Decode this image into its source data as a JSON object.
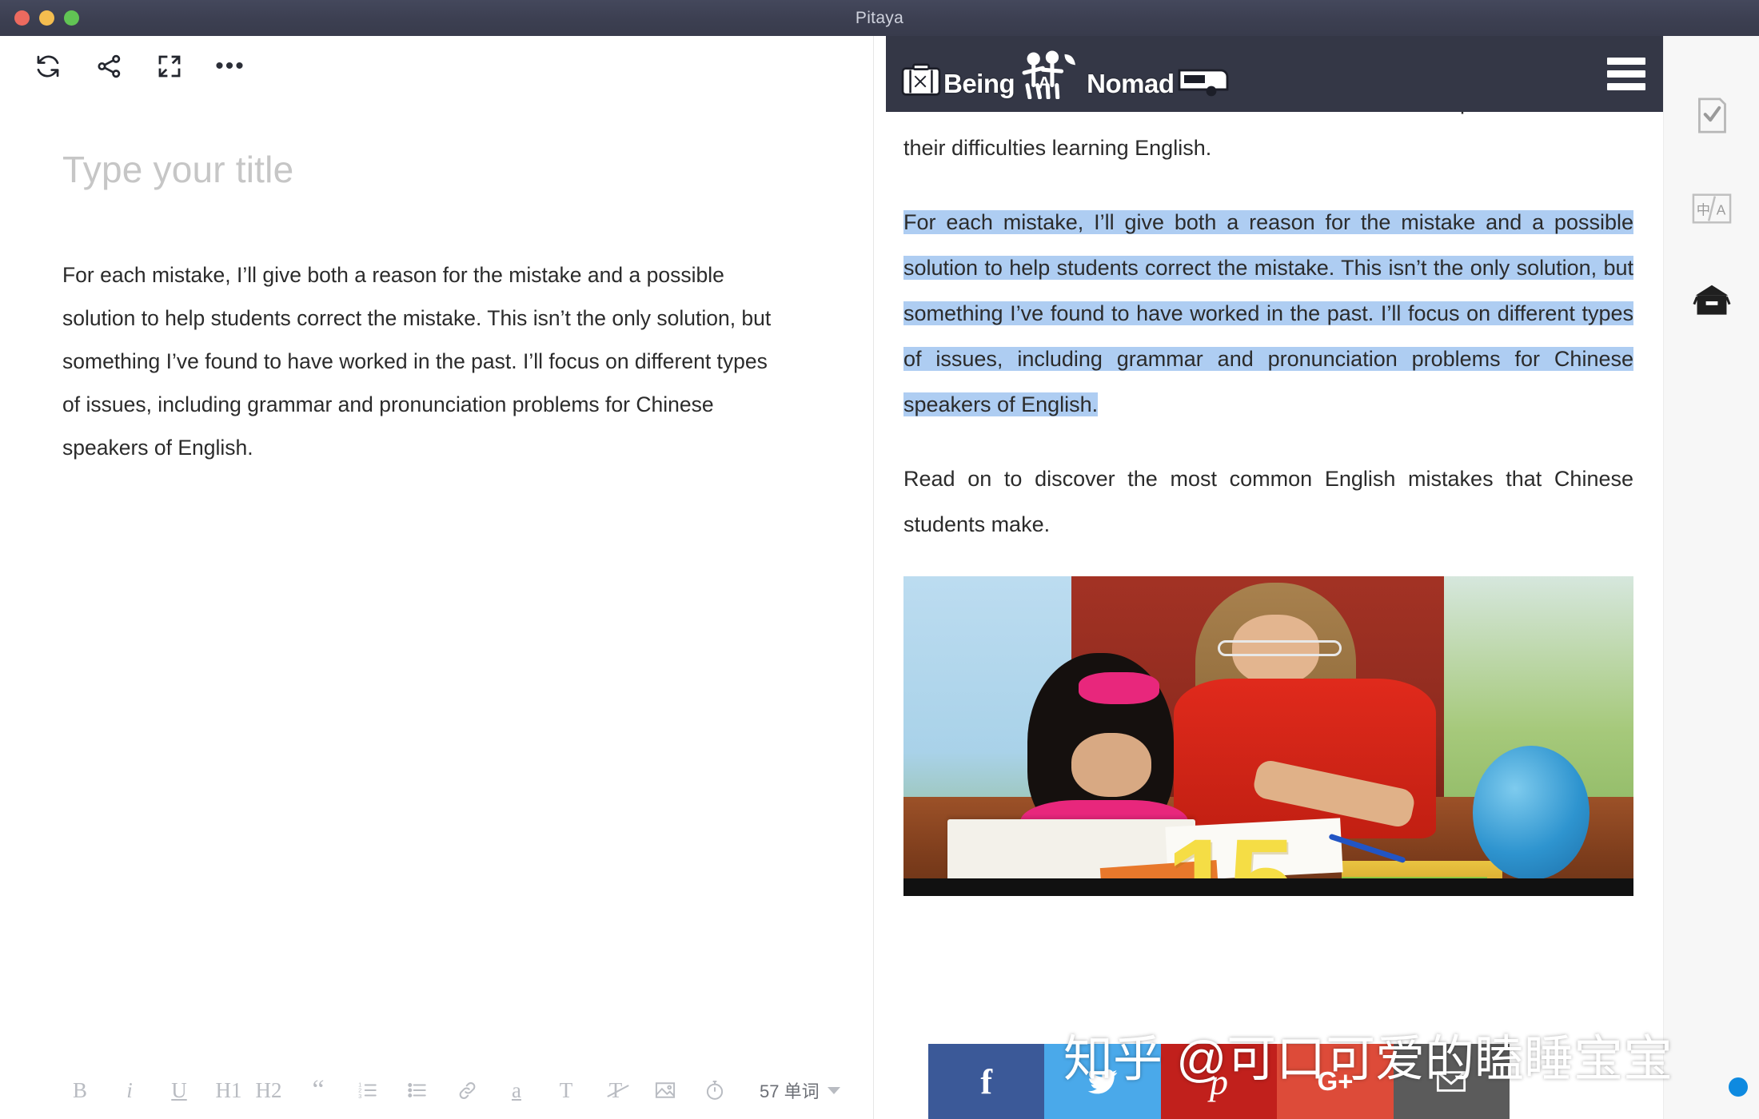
{
  "window": {
    "title": "Pitaya",
    "traffic_lights": [
      "close",
      "minimize",
      "zoom"
    ]
  },
  "editor": {
    "toolbar": [
      {
        "name": "refresh-icon",
        "label": "Refresh"
      },
      {
        "name": "share-icon",
        "label": "Share"
      },
      {
        "name": "fullscreen-icon",
        "label": "Fullscreen"
      },
      {
        "name": "more-options-icon",
        "label": "More"
      }
    ],
    "title_placeholder": "Type your title",
    "title_value": "",
    "body": "For each mistake, I’ll give both a reason for the mistake and a possible solution to help students correct the mistake. This isn’t the only solution, but something I’ve found to have worked in the past. I’ll focus on different types of issues, including grammar and pronunciation problems for Chinese speakers of English."
  },
  "format_bar": {
    "buttons": [
      {
        "name": "bold-button",
        "label": "B"
      },
      {
        "name": "italic-button",
        "label": "i"
      },
      {
        "name": "underline-button",
        "label": "U"
      },
      {
        "name": "heading1-button",
        "label": "H1"
      },
      {
        "name": "heading2-button",
        "label": "H2"
      },
      {
        "name": "blockquote-button",
        "label": "“"
      },
      {
        "name": "ordered-list-button",
        "label": "ordered-list-icon"
      },
      {
        "name": "unordered-list-button",
        "label": "bullet-list-icon"
      },
      {
        "name": "link-button",
        "label": "link-icon"
      },
      {
        "name": "highlight-button",
        "label": "a"
      },
      {
        "name": "text-style-button",
        "label": "T"
      },
      {
        "name": "clear-format-button",
        "label": "strikethrough-T-icon"
      },
      {
        "name": "insert-image-button",
        "label": "image-icon"
      },
      {
        "name": "timer-button",
        "label": "stopwatch-icon"
      }
    ],
    "word_count": "57 单词"
  },
  "preview": {
    "site_header": {
      "logo_text_1": "Being",
      "logo_text_2": "Nomad",
      "logo_icons": [
        "suitcase-icon",
        "family-icon",
        "caravan-icon"
      ],
      "menu": "hamburger-menu-icon"
    },
    "paragraphs": [
      {
        "id": "p-intro",
        "text": "to Chinese students. But students can use it well to help them overcome their difficulties learning English.",
        "selected": false
      },
      {
        "id": "p-selected",
        "text": "For each mistake, I’ll give both a reason for the mistake and a possible solution to help students correct the mistake. This isn’t the only solution, but something I’ve found to have worked in the past. I’ll focus on different types of issues, including grammar and pronunciation problems for Chinese speakers of English.",
        "selected": true
      },
      {
        "id": "p-read-on",
        "text": "Read on to discover the most common English mistakes that Chinese students make.",
        "selected": false
      }
    ],
    "article_image": {
      "alt": "teacher-helping-student-photo",
      "overlay_number": "15"
    },
    "social_buttons": [
      {
        "name": "share-facebook-button",
        "glyph": "f",
        "color": "#3b5998"
      },
      {
        "name": "share-twitter-button",
        "glyph": "twitter-bird-icon",
        "color": "#4aa9ea"
      },
      {
        "name": "share-pinterest-button",
        "glyph": "pinterest-p-icon",
        "color": "#c1201c"
      },
      {
        "name": "share-googleplus-button",
        "glyph": "G+",
        "color": "#dd4b39"
      },
      {
        "name": "share-email-button",
        "glyph": "envelope-icon",
        "color": "#5b5b5b"
      }
    ]
  },
  "watermark": {
    "text": "知乎 @可口可爱的瞌睡宝宝"
  },
  "rail": {
    "items": [
      {
        "name": "rail-item-checklist",
        "label": "document-check-icon"
      },
      {
        "name": "rail-item-translate",
        "label": "translate-zh-en-icon"
      },
      {
        "name": "rail-item-archive",
        "label": "archive-box-icon"
      }
    ]
  },
  "colors": {
    "titlebar": "#3c3f51",
    "site_header": "#343746",
    "selection_highlight": "#aecdf2",
    "rail_bg": "#f7f7f7"
  }
}
